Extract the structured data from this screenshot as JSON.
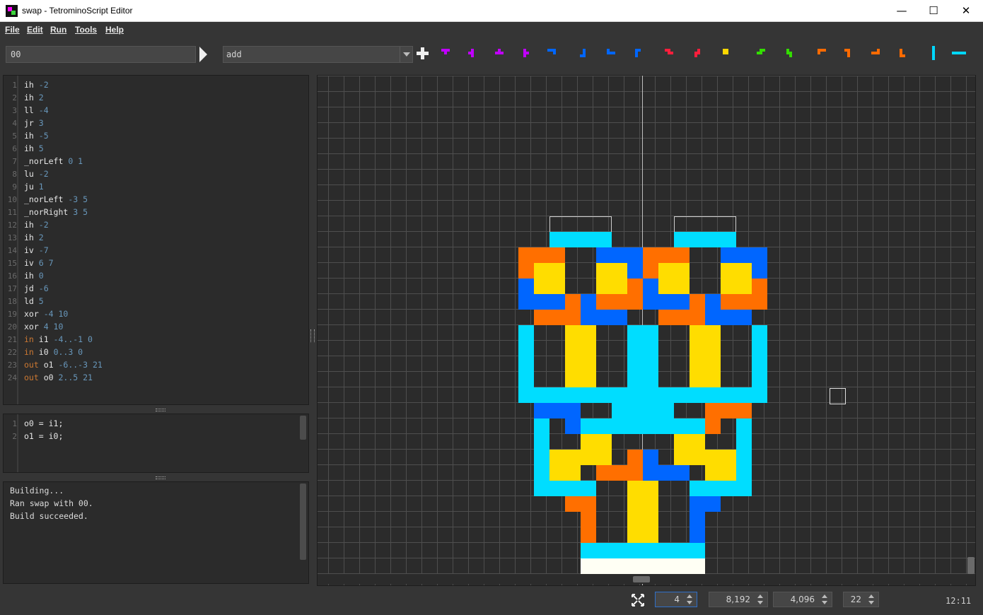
{
  "window": {
    "title": "swap - TetrominoScript Editor",
    "controls": {
      "minimize": "—",
      "maximize": "☐",
      "close": "✕"
    }
  },
  "menu": [
    "File",
    "Edit",
    "Run",
    "Tools",
    "Help"
  ],
  "toolbar": {
    "program_name_input": "00",
    "selected_program": "add",
    "pieces": [
      {
        "name": "t-piece-down",
        "color": "#c000ff"
      },
      {
        "name": "t-piece-left",
        "color": "#c000ff"
      },
      {
        "name": "t-piece-up",
        "color": "#c000ff"
      },
      {
        "name": "t-piece-right",
        "color": "#c000ff"
      },
      {
        "name": "j-piece-a",
        "color": "#0066ff"
      },
      {
        "name": "j-piece-b",
        "color": "#0066ff"
      },
      {
        "name": "j-piece-c",
        "color": "#0066ff"
      },
      {
        "name": "j-piece-d",
        "color": "#0066ff"
      },
      {
        "name": "z-piece-h",
        "color": "#ff1e3c"
      },
      {
        "name": "z-piece-v",
        "color": "#ff1e3c"
      },
      {
        "name": "o-piece",
        "color": "#ffd700"
      },
      {
        "name": "s-piece-h",
        "color": "#33dd00"
      },
      {
        "name": "s-piece-v",
        "color": "#33dd00"
      },
      {
        "name": "l-piece-a",
        "color": "#ff6a00"
      },
      {
        "name": "l-piece-b",
        "color": "#ff6a00"
      },
      {
        "name": "l-piece-c",
        "color": "#ff6a00"
      },
      {
        "name": "l-piece-d",
        "color": "#ff6a00"
      },
      {
        "name": "i-piece-v",
        "color": "#00d8ff"
      },
      {
        "name": "i-piece-h",
        "color": "#00d8ff"
      }
    ]
  },
  "code_lines": [
    [
      {
        "t": "ih ",
        "c": "op"
      },
      {
        "t": "-2",
        "c": "num"
      }
    ],
    [
      {
        "t": "ih ",
        "c": "op"
      },
      {
        "t": "2",
        "c": "num"
      }
    ],
    [
      {
        "t": "ll ",
        "c": "op"
      },
      {
        "t": "-4",
        "c": "num"
      }
    ],
    [
      {
        "t": "jr ",
        "c": "op"
      },
      {
        "t": "3",
        "c": "num"
      }
    ],
    [
      {
        "t": "ih ",
        "c": "op"
      },
      {
        "t": "-5",
        "c": "num"
      }
    ],
    [
      {
        "t": "ih ",
        "c": "op"
      },
      {
        "t": "5",
        "c": "num"
      }
    ],
    [
      {
        "t": "_norLeft ",
        "c": "op"
      },
      {
        "t": "0 1",
        "c": "num"
      }
    ],
    [
      {
        "t": "lu ",
        "c": "op"
      },
      {
        "t": "-2",
        "c": "num"
      }
    ],
    [
      {
        "t": "ju ",
        "c": "op"
      },
      {
        "t": "1",
        "c": "num"
      }
    ],
    [
      {
        "t": "_norLeft ",
        "c": "op"
      },
      {
        "t": "-3 5",
        "c": "num"
      }
    ],
    [
      {
        "t": "_norRight ",
        "c": "op"
      },
      {
        "t": "3 5",
        "c": "num"
      }
    ],
    [
      {
        "t": "ih ",
        "c": "op"
      },
      {
        "t": "-2",
        "c": "num"
      }
    ],
    [
      {
        "t": "ih ",
        "c": "op"
      },
      {
        "t": "2",
        "c": "num"
      }
    ],
    [
      {
        "t": "iv ",
        "c": "op"
      },
      {
        "t": "-7",
        "c": "num"
      }
    ],
    [
      {
        "t": "iv ",
        "c": "op"
      },
      {
        "t": "6 7",
        "c": "num"
      }
    ],
    [
      {
        "t": "ih ",
        "c": "op"
      },
      {
        "t": "0",
        "c": "num"
      }
    ],
    [
      {
        "t": "jd ",
        "c": "op"
      },
      {
        "t": "-6",
        "c": "num"
      }
    ],
    [
      {
        "t": "ld ",
        "c": "op"
      },
      {
        "t": "5",
        "c": "num"
      }
    ],
    [
      {
        "t": "xor ",
        "c": "op"
      },
      {
        "t": "-4 10",
        "c": "num"
      }
    ],
    [
      {
        "t": "xor ",
        "c": "op"
      },
      {
        "t": "4 10",
        "c": "num"
      }
    ],
    [
      {
        "t": "in ",
        "c": "io"
      },
      {
        "t": "i1 ",
        "c": "op"
      },
      {
        "t": "-4..-1 0",
        "c": "num"
      }
    ],
    [
      {
        "t": "in ",
        "c": "io"
      },
      {
        "t": "i0 ",
        "c": "op"
      },
      {
        "t": "0..3 0",
        "c": "num"
      }
    ],
    [
      {
        "t": "out ",
        "c": "io"
      },
      {
        "t": "o1 ",
        "c": "op"
      },
      {
        "t": "-6..-3 21",
        "c": "num"
      }
    ],
    [
      {
        "t": "out ",
        "c": "io"
      },
      {
        "t": "o0 ",
        "c": "op"
      },
      {
        "t": "2..5 21",
        "c": "num"
      }
    ]
  ],
  "expr_lines": [
    "o0 = i1;",
    "o1 = i0;"
  ],
  "output_lines": [
    "Building...",
    "Ran swap with 00.",
    "Build succeeded."
  ],
  "grid": {
    "colors": {
      "I": "#00ddff",
      "O": "#ffdd00",
      "L": "#ff6f00",
      "J": "#0066ff",
      "white": "#fffff4"
    },
    "cells": [
      "I:-6,0",
      "I:-5,0",
      "I:-4,0",
      "I:-3,0",
      "I:2,0",
      "I:3,0",
      "I:4,0",
      "I:5,0",
      "L:-8,1",
      "L:-7,1",
      "L:-6,1",
      "J:-3,1",
      "J:-2,1",
      "J:-1,1",
      "L:0,1",
      "L:1,1",
      "L:2,1",
      "J:5,1",
      "J:6,1",
      "J:7,1",
      "L:-8,2",
      "O:-7,2",
      "O:-6,2",
      "O:-3,2",
      "O:-2,2",
      "J:-1,2",
      "L:0,2",
      "O:1,2",
      "O:2,2",
      "O:5,2",
      "O:6,2",
      "J:7,2",
      "J:-8,3",
      "O:-7,3",
      "O:-6,3",
      "O:-3,3",
      "O:-2,3",
      "L:-1,3",
      "J:0,3",
      "O:1,3",
      "O:2,3",
      "O:5,3",
      "O:6,3",
      "L:7,3",
      "J:-8,4",
      "J:-7,4",
      "J:-6,4",
      "L:-5,4",
      "J:-4,4",
      "L:-3,4",
      "L:-2,4",
      "L:-1,4",
      "J:0,4",
      "J:1,4",
      "J:2,4",
      "L:3,4",
      "J:4,4",
      "L:5,4",
      "L:6,4",
      "L:7,4",
      "L:-7,5",
      "L:-6,5",
      "L:-5,5",
      "L:-4,5",
      "J:-4,5",
      "J:-3,5",
      "J:-2,5",
      "L:1,5",
      "L:2,5",
      "L:3,5",
      "J:4,5",
      "J:5,5",
      "J:6,5",
      "I:-8,6",
      "O:-5,6",
      "O:-4,6",
      "I:-1,6",
      "I:0,6",
      "O:3,6",
      "O:4,6",
      "I:7,6",
      "I:-8,7",
      "O:-5,7",
      "O:-4,7",
      "I:-1,7",
      "I:0,7",
      "O:3,7",
      "O:4,7",
      "I:7,7",
      "I:-8,8",
      "O:-5,8",
      "O:-4,8",
      "I:-1,8",
      "I:0,8",
      "O:3,8",
      "O:4,8",
      "I:7,8",
      "I:-8,9",
      "O:-5,9",
      "O:-4,9",
      "I:-1,9",
      "I:0,9",
      "O:3,9",
      "O:4,9",
      "I:7,9",
      "I:-8,10",
      "I:-7,10",
      "I:-6,10",
      "I:-5,10",
      "I:-4,10",
      "I:-3,10",
      "I:-2,10",
      "I:-1,10",
      "I:0,10",
      "I:1,10",
      "I:2,10",
      "I:3,10",
      "I:4,10",
      "I:5,10",
      "I:6,10",
      "I:7,10",
      "J:-7,11",
      "J:-6,11",
      "J:-5,11",
      "I:-2,11",
      "I:-1,11",
      "I:0,11",
      "I:1,11",
      "L:4,11",
      "L:5,11",
      "L:6,11",
      "I:-7,12",
      "J:-5,12",
      "I:-4,12",
      "I:-3,12",
      "I:-2,12",
      "I:-1,12",
      "I:0,12",
      "I:1,12",
      "I:2,12",
      "I:3,12",
      "L:4,12",
      "I:6,12",
      "I:-7,13",
      "O:-4,13",
      "O:-3,13",
      "O:2,13",
      "O:3,13",
      "I:6,13",
      "I:-7,14",
      "O:-6,14",
      "O:-5,14",
      "O:-4,14",
      "O:-3,14",
      "L:-1,14",
      "J:0,14",
      "O:2,14",
      "O:3,14",
      "O:4,14",
      "O:5,14",
      "I:6,14",
      "I:-7,15",
      "O:-6,15",
      "O:-5,15",
      "L:-3,15",
      "L:-2,15",
      "L:-1,15",
      "J:0,15",
      "J:1,15",
      "J:2,15",
      "O:4,15",
      "O:5,15",
      "I:6,15",
      "I:-7,16",
      "I:-6,16",
      "I:-5,16",
      "I:-4,16",
      "O:-1,16",
      "O:0,16",
      "I:3,16",
      "I:4,16",
      "I:5,16",
      "I:6,16",
      "L:-5,17",
      "L:-4,17",
      "O:-1,17",
      "O:0,17",
      "J:3,17",
      "J:4,17",
      "L:-4,18",
      "O:-1,18",
      "O:0,18",
      "J:3,18",
      "L:-4,19",
      "O:-1,19",
      "O:0,19",
      "J:3,19",
      "I:-4,20",
      "I:-3,20",
      "I:-2,20",
      "I:-1,20",
      "I:0,20",
      "I:1,20",
      "I:2,20",
      "I:3,20",
      "white:-4,21",
      "white:-3,21",
      "white:-2,21",
      "white:-1,21",
      "white:0,21",
      "white:1,21",
      "white:2,21",
      "white:3,21"
    ]
  },
  "status": {
    "scale": "4",
    "width": "8,192",
    "height": "4,096",
    "zoom": "22",
    "time": "12:11"
  }
}
